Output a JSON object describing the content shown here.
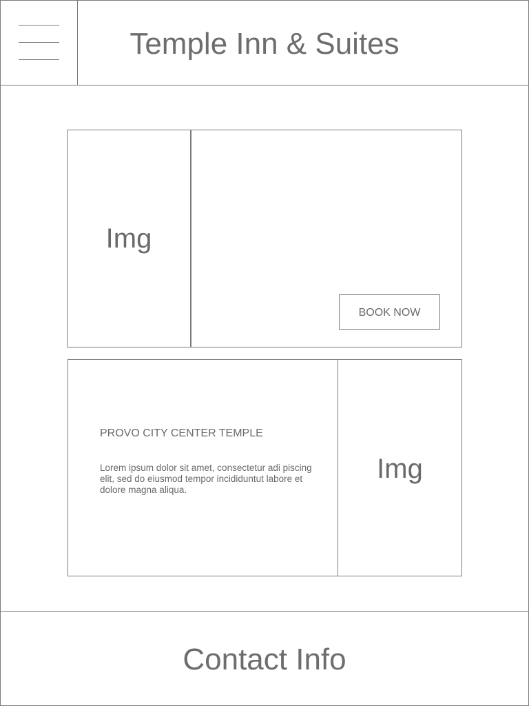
{
  "header": {
    "title": "Temple Inn & Suites",
    "menu_icon": "hamburger-menu-icon"
  },
  "hero_card": {
    "image_placeholder": "Img",
    "book_button_label": "BOOK NOW"
  },
  "temple_card": {
    "heading": "PROVO CITY CENTER TEMPLE",
    "body": "Lorem ipsum dolor sit amet, consectetur adi piscing elit, sed do eiusmod tempor incididuntut labore et dolore magna aliqua.",
    "image_placeholder": "Img"
  },
  "footer": {
    "title": "Contact Info"
  },
  "colors": {
    "line": "#7a7a7a",
    "text": "#6d6d6d",
    "background": "#ffffff"
  }
}
